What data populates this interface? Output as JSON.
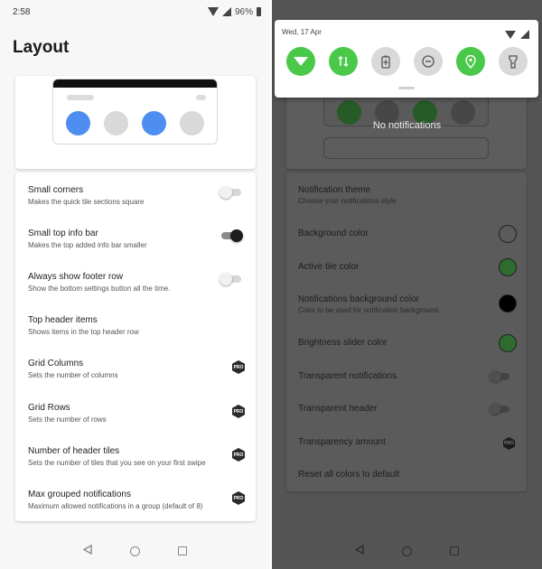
{
  "left": {
    "status": {
      "time": "2:58",
      "battery": "96%"
    },
    "title": "Layout",
    "settings": [
      {
        "title": "Small corners",
        "subtitle": "Makes the quick tile sections square",
        "control": "toggle",
        "on": false
      },
      {
        "title": "Small top info bar",
        "subtitle": "Makes the top added info bar smaller",
        "control": "toggle",
        "on": true
      },
      {
        "title": "Always show footer row",
        "subtitle": "Show the bottom settings button all the time.",
        "control": "toggle",
        "on": false
      },
      {
        "title": "Top header items",
        "subtitle": "Shows items in the top header row",
        "control": "none"
      },
      {
        "title": "Grid Columns",
        "subtitle": "Sets the number of columns",
        "control": "pro"
      },
      {
        "title": "Grid Rows",
        "subtitle": "Sets the number of rows",
        "control": "pro"
      },
      {
        "title": "Number of header tiles",
        "subtitle": "Sets the number of tiles that you see on your first swipe",
        "control": "pro"
      },
      {
        "title": "Max grouped notifications",
        "subtitle": "Maximum allowed notifications in a group (default of 8)",
        "control": "pro"
      }
    ],
    "pro_label": "PRO",
    "preview_tile_colors": [
      "#4d8ef0",
      "#d9d9d9",
      "#4d8ef0",
      "#d9d9d9"
    ]
  },
  "right": {
    "shade": {
      "date": "Wed, 17 Apr",
      "tiles": [
        {
          "icon": "wifi-icon",
          "active": true
        },
        {
          "icon": "mobile-data-icon",
          "active": true
        },
        {
          "icon": "battery-saver-icon",
          "active": false
        },
        {
          "icon": "do-not-disturb-icon",
          "active": false
        },
        {
          "icon": "location-icon",
          "active": true
        },
        {
          "icon": "flashlight-icon",
          "active": false
        }
      ]
    },
    "no_notifications": "No notifications",
    "settings": [
      {
        "title": "Notification theme",
        "subtitle": "Choose your notifications style",
        "control": "none"
      },
      {
        "title": "Background color",
        "control": "swatch",
        "color": "#5b5b5b"
      },
      {
        "title": "Active tile color",
        "control": "swatch",
        "color": "#2e6b2e"
      },
      {
        "title": "Notifications background color",
        "subtitle": "Color to be used for notification background.",
        "control": "swatch",
        "color": "#000000"
      },
      {
        "title": "Brightness slider color",
        "control": "swatch",
        "color": "#2e6b2e"
      },
      {
        "title": "Transparent notifications",
        "control": "toggle",
        "on": false
      },
      {
        "title": "Transparent header",
        "control": "toggle",
        "on": false
      },
      {
        "title": "Transparency amount",
        "control": "pro"
      },
      {
        "title": "Reset all colors to default",
        "control": "none"
      }
    ],
    "pro_label": "PRO"
  },
  "colors": {
    "accent_blue": "#4d8ef0",
    "active_green": "#49c849",
    "dim_overlay": "#555555"
  }
}
